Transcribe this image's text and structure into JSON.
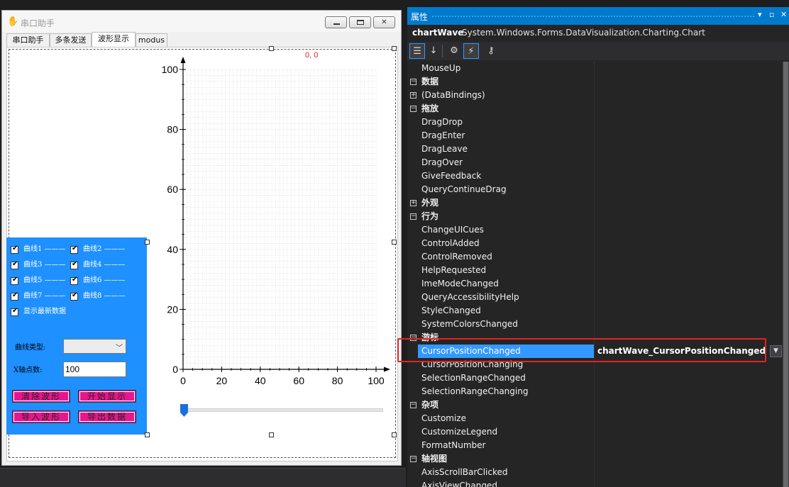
{
  "form": {
    "title": "串口助手",
    "tabs": [
      "串口助手",
      "多条发送",
      "波形显示",
      "modus"
    ],
    "active_tab": 2
  },
  "panel": {
    "checkboxes": [
      {
        "label": "曲线1 ———",
        "checked": true
      },
      {
        "label": "曲线2 ———",
        "checked": true
      },
      {
        "label": "曲线3 ———",
        "checked": true
      },
      {
        "label": "曲线4 ———",
        "checked": true
      },
      {
        "label": "曲线5 ———",
        "checked": true
      },
      {
        "label": "曲线6 ———",
        "checked": true
      },
      {
        "label": "曲线7 ———",
        "checked": true
      },
      {
        "label": "曲线8 ———",
        "checked": true
      },
      {
        "label": "显示最新数据",
        "checked": true
      }
    ],
    "curve_type_label": "曲线类型:",
    "curve_type_value": "",
    "x_points_label": "X轴点数:",
    "x_points_value": "100",
    "buttons": {
      "clear": "清除波形",
      "start": "开始显示",
      "import": "导入波形",
      "export": "导出数据"
    },
    "color": "#1e90ff",
    "button_color": "#e6178e"
  },
  "chart_data": {
    "type": "line",
    "cursor_readout": "0, 0",
    "x_ticks": [
      "0",
      "20",
      "40",
      "60",
      "80",
      "100"
    ],
    "y_ticks": [
      "0",
      "20",
      "40",
      "60",
      "80",
      "100"
    ],
    "xlim": [
      0,
      100
    ],
    "ylim": [
      0,
      100
    ],
    "grid": true,
    "series": []
  },
  "properties": {
    "title": "属性",
    "object_name": "chartWave",
    "object_type": "System.Windows.Forms.DataVisualization.Charting.Chart",
    "toolbar": [
      "categorized-icon",
      "alphabetical-icon",
      "properties-icon",
      "events-icon",
      "property-pages-icon"
    ],
    "rows": [
      {
        "type": "item",
        "name": "MouseUp"
      },
      {
        "type": "cat",
        "name": "数据",
        "expanded": true
      },
      {
        "type": "item",
        "name": "(DataBindings)",
        "expandable": true
      },
      {
        "type": "cat",
        "name": "拖放",
        "expanded": true
      },
      {
        "type": "item",
        "name": "DragDrop"
      },
      {
        "type": "item",
        "name": "DragEnter"
      },
      {
        "type": "item",
        "name": "DragLeave"
      },
      {
        "type": "item",
        "name": "DragOver"
      },
      {
        "type": "item",
        "name": "GiveFeedback"
      },
      {
        "type": "item",
        "name": "QueryContinueDrag"
      },
      {
        "type": "cat",
        "name": "外观",
        "expanded": false
      },
      {
        "type": "cat",
        "name": "行为",
        "expanded": true
      },
      {
        "type": "item",
        "name": "ChangeUICues"
      },
      {
        "type": "item",
        "name": "ControlAdded"
      },
      {
        "type": "item",
        "name": "ControlRemoved"
      },
      {
        "type": "item",
        "name": "HelpRequested"
      },
      {
        "type": "item",
        "name": "ImeModeChanged"
      },
      {
        "type": "item",
        "name": "QueryAccessibilityHelp"
      },
      {
        "type": "item",
        "name": "StyleChanged"
      },
      {
        "type": "item",
        "name": "SystemColorsChanged"
      },
      {
        "type": "cat",
        "name": "游标",
        "expanded": true
      },
      {
        "type": "sel",
        "name": "CursorPositionChanged",
        "value": "chartWave_CursorPositionChanged"
      },
      {
        "type": "item",
        "name": "CursorPositionChanging"
      },
      {
        "type": "item",
        "name": "SelectionRangeChanged"
      },
      {
        "type": "item",
        "name": "SelectionRangeChanging"
      },
      {
        "type": "cat",
        "name": "杂项",
        "expanded": true
      },
      {
        "type": "item",
        "name": "Customize"
      },
      {
        "type": "item",
        "name": "CustomizeLegend"
      },
      {
        "type": "item",
        "name": "FormatNumber"
      },
      {
        "type": "cat",
        "name": "轴视图",
        "expanded": true
      },
      {
        "type": "item",
        "name": "AxisScrollBarClicked"
      },
      {
        "type": "item",
        "name": "AxisViewChanged"
      }
    ],
    "accent": "#007acc",
    "selection": "#3399ff",
    "highlight": "#e8231f"
  }
}
